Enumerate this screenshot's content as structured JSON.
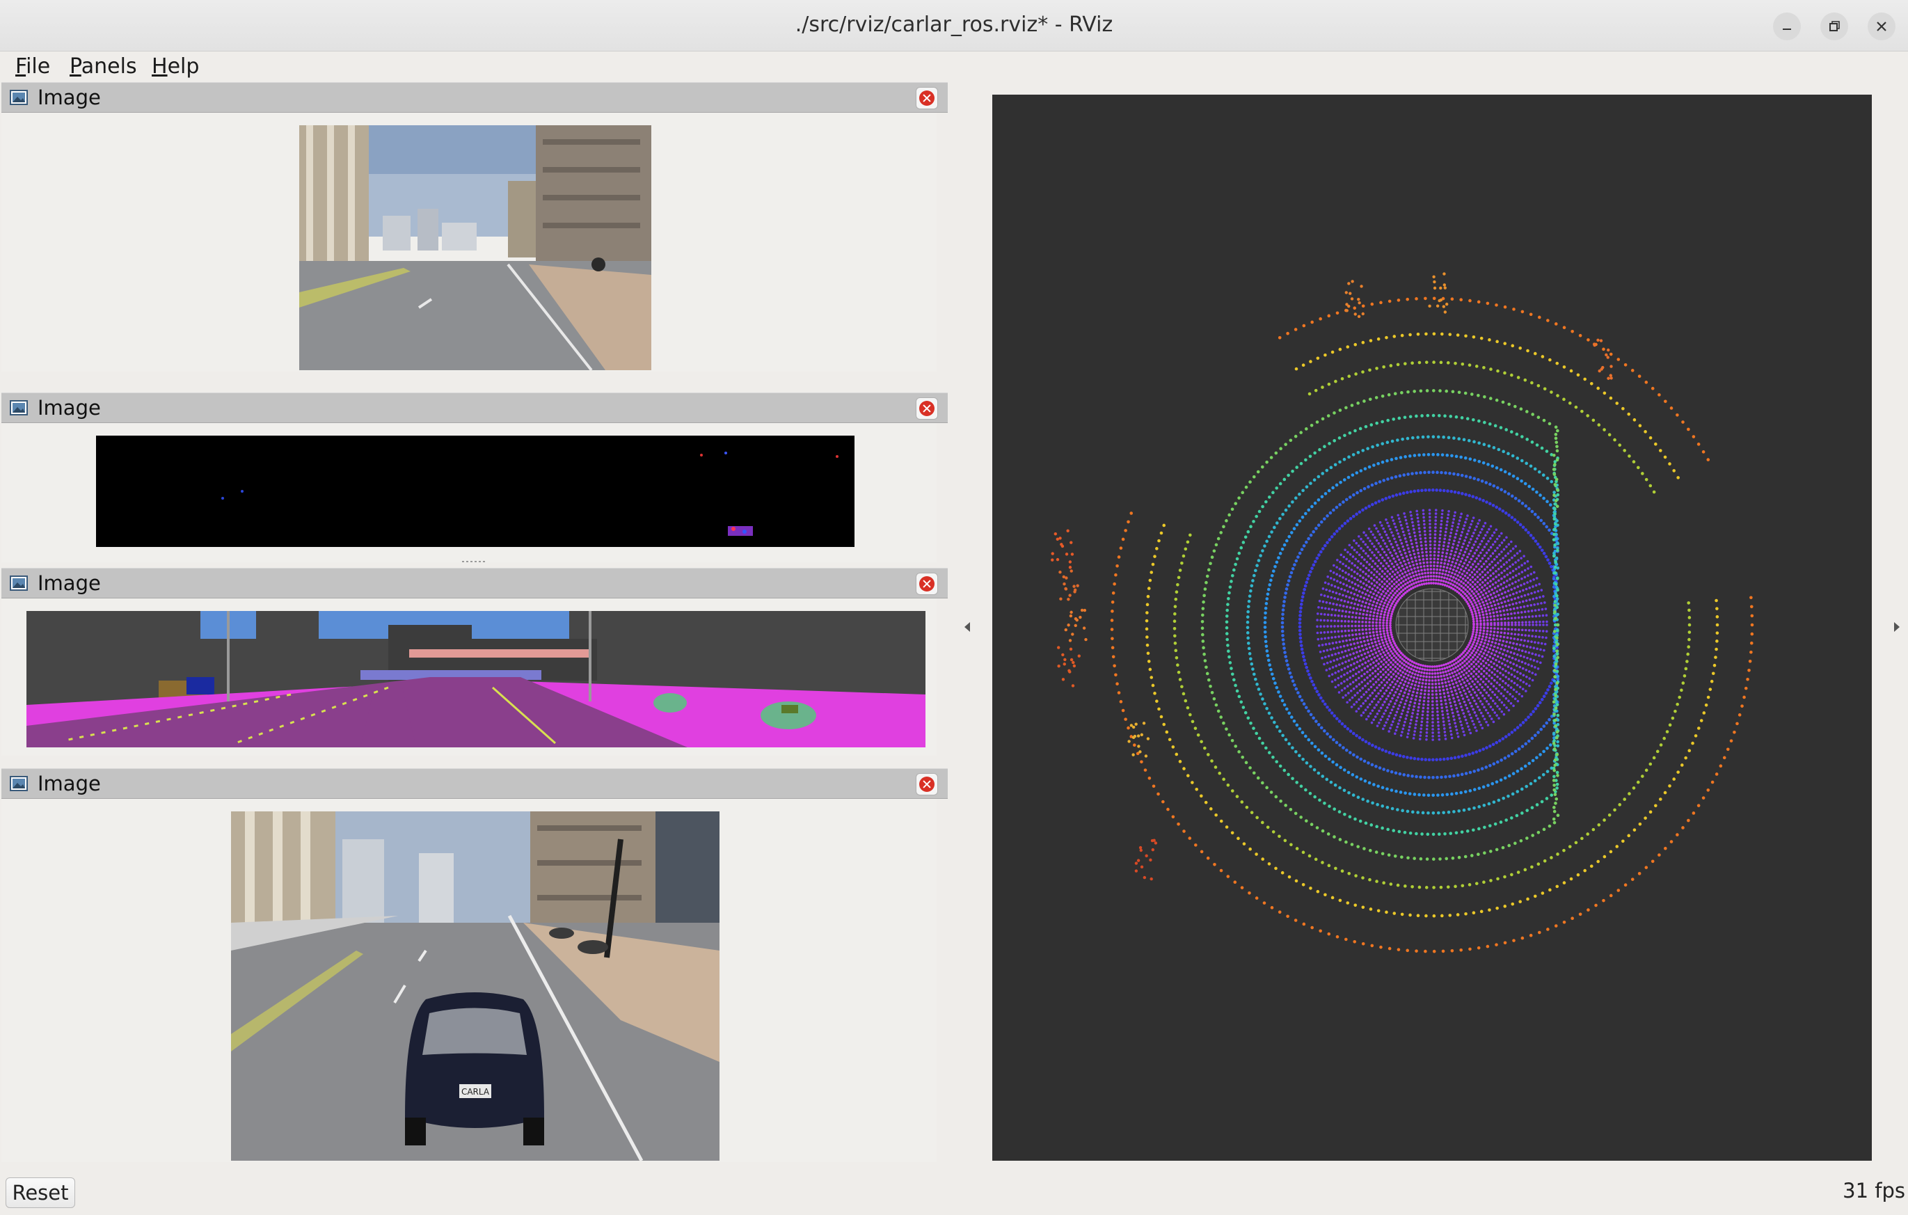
{
  "window": {
    "title": "./src/rviz/carlar_ros.rviz* - RViz",
    "buttons": [
      "minimize-icon",
      "maximize-icon",
      "close-icon"
    ]
  },
  "menubar": {
    "items": [
      {
        "label": "File",
        "mnemonic": "F",
        "rest": "ile"
      },
      {
        "label": "Panels",
        "mnemonic": "P",
        "rest": "anels"
      },
      {
        "label": "Help",
        "mnemonic": "H",
        "rest": "elp"
      }
    ]
  },
  "panels": [
    {
      "title": "Image",
      "content": "rgb-camera-front",
      "icon": "image-icon"
    },
    {
      "title": "Image",
      "content": "depth-or-event-camera",
      "icon": "image-icon"
    },
    {
      "title": "Image",
      "content": "semantic-segmentation-camera",
      "icon": "image-icon"
    },
    {
      "title": "Image",
      "content": "chase-camera",
      "icon": "image-icon"
    }
  ],
  "view3d": {
    "display": "lidar-point-cloud",
    "background": "#303030"
  },
  "footer": {
    "reset_label": "Reset",
    "fps": "31 fps"
  },
  "colors": {
    "panel_header": "#c3c3c3",
    "window_bg": "#efedea",
    "close_red": "#d93025"
  }
}
